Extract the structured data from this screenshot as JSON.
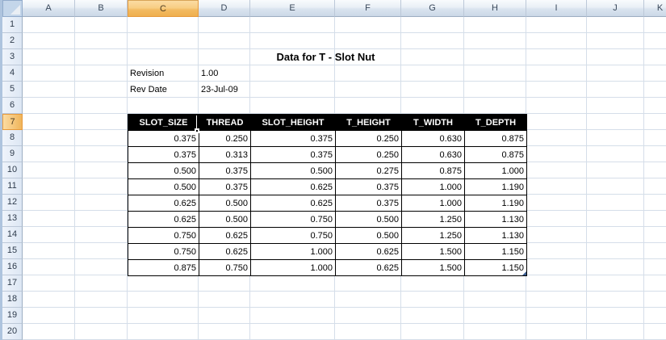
{
  "sheet": {
    "title": "Data for T - Slot Nut",
    "selected_column": "C",
    "selected_row": 7,
    "column_headers": [
      "A",
      "B",
      "C",
      "D",
      "E",
      "F",
      "G",
      "H",
      "I",
      "J",
      "K"
    ],
    "visible_row_count": 20,
    "meta": {
      "revision_label": "Revision",
      "revision_value": "1.00",
      "revdate_label": "Rev Date",
      "revdate_value": "23-Jul-09"
    },
    "table": {
      "columns": [
        "C",
        "D",
        "E",
        "F",
        "G",
        "H"
      ],
      "first_data_row": 8,
      "headers": [
        "SLOT_SIZE",
        "THREAD",
        "SLOT_HEIGHT",
        "T_HEIGHT",
        "T_WIDTH",
        "T_DEPTH"
      ],
      "rows": [
        [
          "0.375",
          "0.250",
          "0.375",
          "0.250",
          "0.630",
          "0.875"
        ],
        [
          "0.375",
          "0.313",
          "0.375",
          "0.250",
          "0.630",
          "0.875"
        ],
        [
          "0.500",
          "0.375",
          "0.500",
          "0.275",
          "0.875",
          "1.000"
        ],
        [
          "0.500",
          "0.375",
          "0.625",
          "0.375",
          "1.000",
          "1.190"
        ],
        [
          "0.625",
          "0.500",
          "0.625",
          "0.375",
          "1.000",
          "1.190"
        ],
        [
          "0.625",
          "0.500",
          "0.750",
          "0.500",
          "1.250",
          "1.130"
        ],
        [
          "0.750",
          "0.625",
          "0.750",
          "0.500",
          "1.250",
          "1.130"
        ],
        [
          "0.750",
          "0.625",
          "1.000",
          "0.625",
          "1.500",
          "1.150"
        ],
        [
          "0.875",
          "0.750",
          "1.000",
          "0.625",
          "1.500",
          "1.150"
        ]
      ]
    }
  },
  "colors": {
    "selection_accent": "#EFAF4E",
    "selection_border": "#E79A3C",
    "gridline": "#D5DEE9",
    "header_text": "#39485A",
    "table_border": "#000000",
    "table_header_bg": "#000000",
    "table_header_text": "#FFFFFF",
    "table_end_marker": "#3C5E91"
  }
}
